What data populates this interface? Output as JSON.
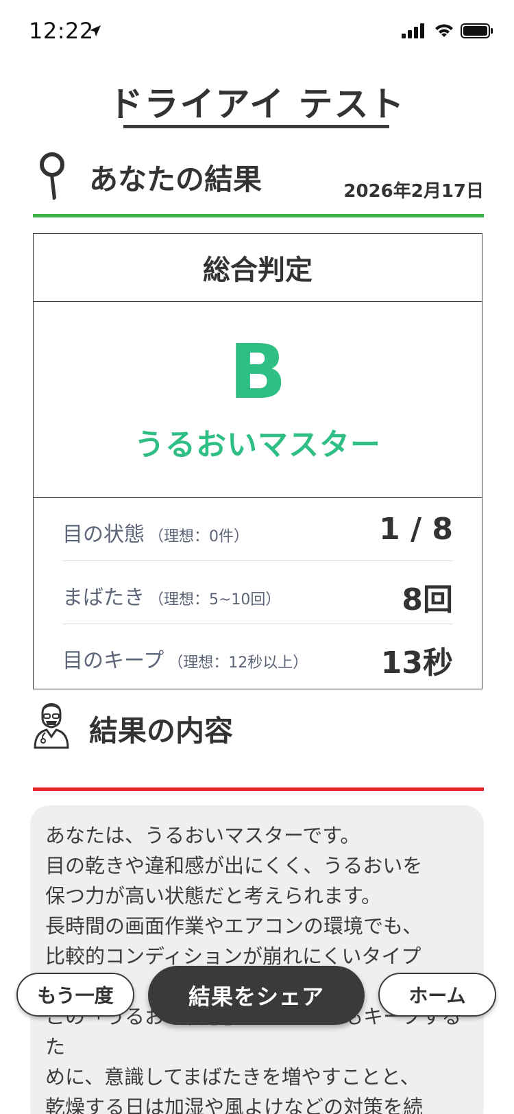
{
  "status_bar": {
    "time": "12:22",
    "icons": [
      "location-arrow-icon",
      "cellular-signal-icon",
      "wifi-icon",
      "battery-icon"
    ]
  },
  "title": "ドライアイ テスト",
  "result_section": {
    "title": "あなたの結果",
    "date": "2026年2月17日",
    "icon": "pin-icon",
    "accent_color": "#3cb34a"
  },
  "result_box": {
    "header": "総合判定",
    "grade": "B",
    "grade_name": "うるおいマスター",
    "grade_color": "#2fbf84",
    "metrics": [
      {
        "label": "目の状態",
        "ideal": "（理想：0件）",
        "value": "1 / 8"
      },
      {
        "label": "まばたき",
        "ideal": "（理想：5~10回）",
        "value": "8回"
      },
      {
        "label": "目のキープ",
        "ideal": "（理想：12秒以上）",
        "value": "13秒"
      }
    ]
  },
  "content_section": {
    "title": "結果の内容",
    "icon": "doctor-icon",
    "accent_color": "#e8232a",
    "description": "あなたは、うるおいマスターです。\n目の乾きや違和感が出にくく、うるおいを\n保つ力が高い状態だと考えられます。\n長時間の画面作業やエアコンの環境でも、\n比較的コンディションが崩れにくいタイプ\nです。\nこの「うるおい状態」をこれからもキープするた\nめに、意識してまばたきを増やすことと、\n乾燥する日は加湿や風よけなどの対策を続\nけましょう。"
  },
  "buttons": {
    "again": "もう一度",
    "share": "結果をシェア",
    "home": "ホーム"
  }
}
